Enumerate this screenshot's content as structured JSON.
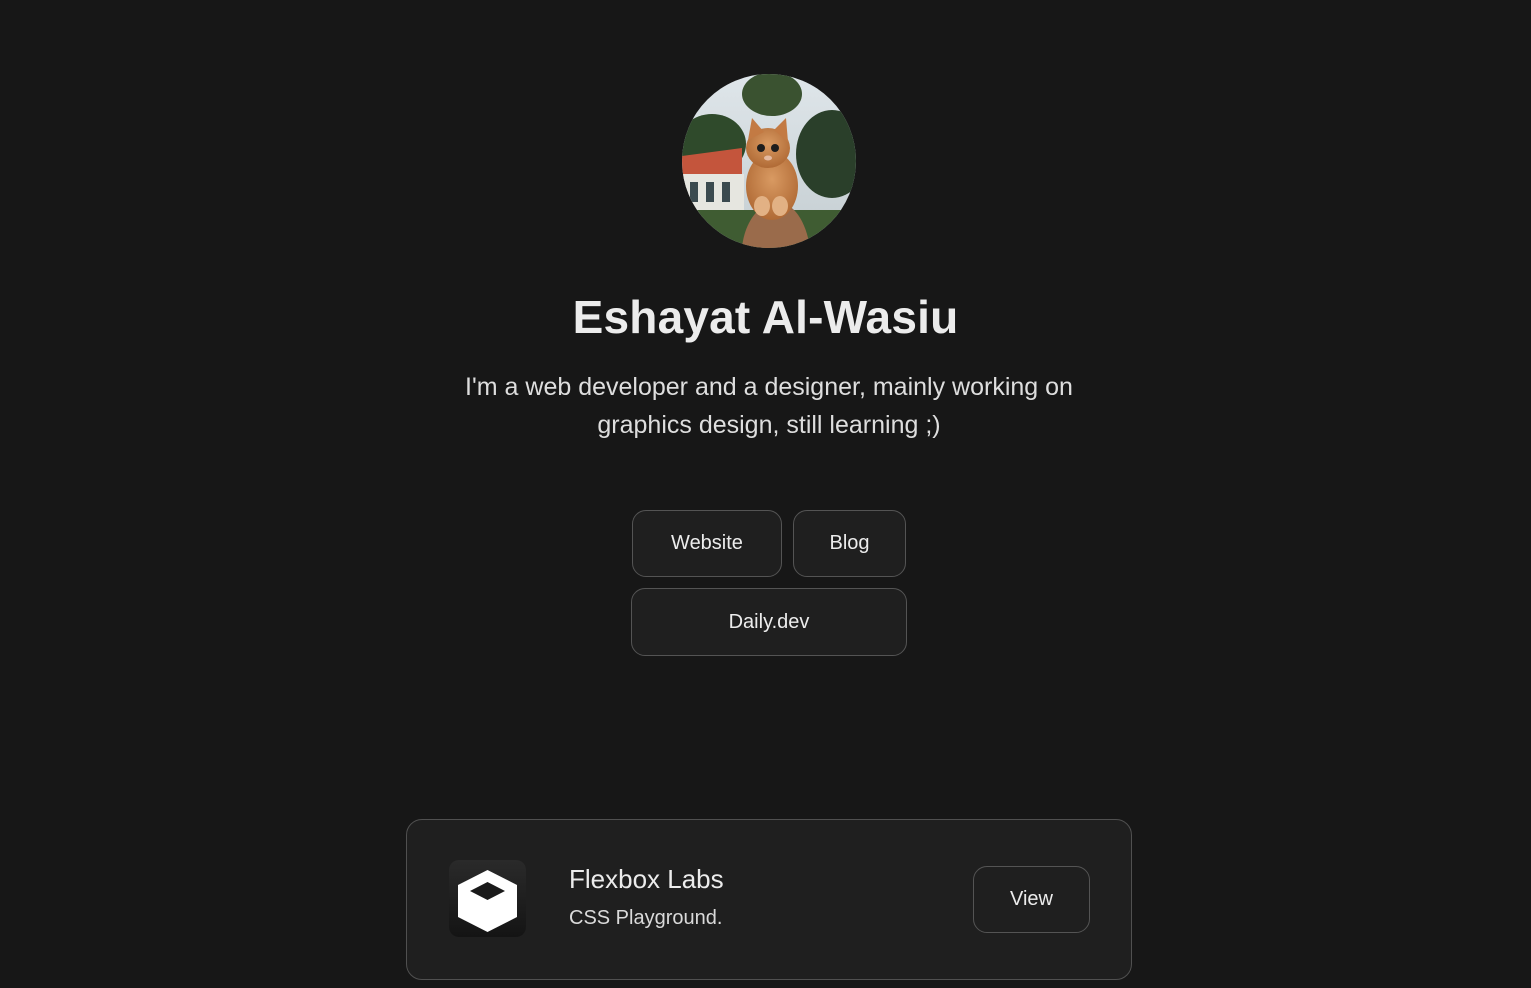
{
  "profile": {
    "name": "Eshayat Al-Wasiu",
    "bio": "I'm a web developer and a designer, mainly working on graphics design, still learning ;)",
    "avatar_icon": "cat-photo-avatar"
  },
  "links": {
    "website": "Website",
    "blog": "Blog",
    "daily": "Daily.dev"
  },
  "project": {
    "title": "Flexbox Labs",
    "subtitle": "CSS Playground.",
    "action": "View",
    "icon": "cube-icon"
  },
  "colors": {
    "background": "#171717",
    "surface": "#1f1f1f",
    "border": "#545454",
    "text": "#ececec"
  }
}
